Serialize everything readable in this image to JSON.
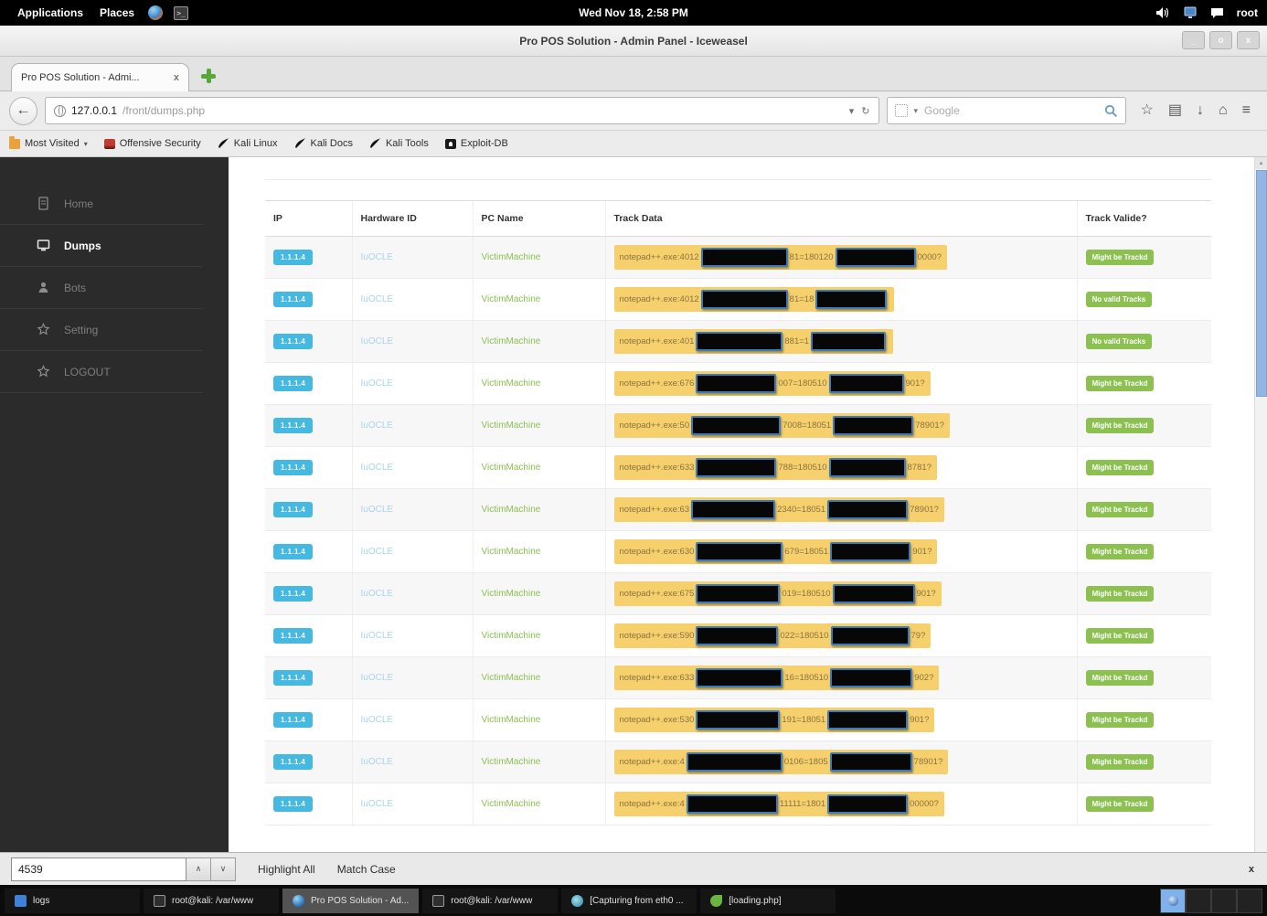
{
  "desktop": {
    "top_bar": {
      "menus": [
        "Applications",
        "Places"
      ],
      "clock": "Wed Nov 18, 2:58 PM",
      "user": "root"
    },
    "taskbar": {
      "items": [
        {
          "label": "logs",
          "icon": "file",
          "active": false
        },
        {
          "label": "root@kali: /var/www",
          "icon": "terminal",
          "active": false
        },
        {
          "label": "Pro POS Solution - Ad...",
          "icon": "iceweasel",
          "active": true
        },
        {
          "label": "root@kali: /var/www",
          "icon": "terminal",
          "active": false
        },
        {
          "label": "[Capturing from eth0 ...",
          "icon": "wireshark",
          "active": false
        },
        {
          "label": "[loading.php]",
          "icon": "script",
          "active": false
        }
      ],
      "workspace_count": 4,
      "active_workspace": 0
    }
  },
  "browser": {
    "window_title": "Pro POS Solution - Admin Panel - Iceweasel",
    "win_controls": {
      "minimize": "_",
      "maximize": "o",
      "close": "x"
    },
    "tab": {
      "title": "Pro POS Solution - Admi...",
      "close": "x"
    },
    "url": {
      "host": "127.0.0.1",
      "path": "/front/dumps.php"
    },
    "nav": {
      "back": "←",
      "url_caret": "▾",
      "reload": "↻",
      "search_caret": "▾",
      "star": "☆",
      "panel": "▤",
      "download": "↓",
      "home": "⌂",
      "menu": "≡"
    },
    "search_placeholder": "Google",
    "bookmarks": [
      {
        "label": "Most Visited",
        "icon": "folder",
        "caret": "▾"
      },
      {
        "label": "Offensive Security",
        "icon": "offsec"
      },
      {
        "label": "Kali Linux",
        "icon": "kali"
      },
      {
        "label": "Kali Docs",
        "icon": "kali"
      },
      {
        "label": "Kali Tools",
        "icon": "kali"
      },
      {
        "label": "Exploit-DB",
        "icon": "edb"
      }
    ],
    "findbar": {
      "query": "4539",
      "prev": "∧",
      "next": "∨",
      "highlight_all": "Highlight All",
      "match_case": "Match Case",
      "close": "x"
    },
    "scrollbar_arrow": "▴"
  },
  "page": {
    "sidebar": [
      {
        "label": "Home",
        "icon": "home",
        "active": false
      },
      {
        "label": "Dumps",
        "icon": "dumps",
        "active": true
      },
      {
        "label": "Bots",
        "icon": "bots",
        "active": false
      },
      {
        "label": "Setting",
        "icon": "setting",
        "active": false
      },
      {
        "label": "LOGOUT",
        "icon": "logout",
        "active": false
      }
    ],
    "table": {
      "headers": [
        "IP",
        "Hardware ID",
        "PC Name",
        "Track Data",
        "Track Valide?"
      ],
      "rows": [
        {
          "ip": "1.1.1.4",
          "hwid": "IuOCLE",
          "pc": "VictimMachine",
          "track": {
            "pre": "notepad++.exe:4012",
            "mid": "81=180120",
            "end": "0000?",
            "redact_widths": [
              95,
              88
            ]
          },
          "valid": "Might be Trackd"
        },
        {
          "ip": "1.1.1.4",
          "hwid": "IuOCLE",
          "pc": "VictimMachine",
          "track": {
            "pre": "notepad++.exe:4012",
            "mid": "81=18",
            "end": "",
            "redact_widths": [
              95,
              78
            ]
          },
          "valid": "No valid Tracks"
        },
        {
          "ip": "1.1.1.4",
          "hwid": "IuOCLE",
          "pc": "VictimMachine",
          "track": {
            "pre": "notepad++.exe:401",
            "mid": "881=1",
            "end": "",
            "redact_widths": [
              95,
              82
            ]
          },
          "valid": "No valid Tracks"
        },
        {
          "ip": "1.1.1.4",
          "hwid": "IuOCLE",
          "pc": "VictimMachine",
          "track": {
            "pre": "notepad++.exe:676",
            "mid": "007=180510",
            "end": "901?",
            "redact_widths": [
              88,
              82
            ]
          },
          "valid": "Might be Trackd"
        },
        {
          "ip": "1.1.1.4",
          "hwid": "IuOCLE",
          "pc": "VictimMachine",
          "track": {
            "pre": "notepad++.exe:50",
            "mid": "7008=18051",
            "end": "78901?",
            "redact_widths": [
              98,
              88
            ]
          },
          "valid": "Might be Trackd"
        },
        {
          "ip": "1.1.1.4",
          "hwid": "IuOCLE",
          "pc": "VictimMachine",
          "track": {
            "pre": "notepad++.exe:633",
            "mid": "788=180510",
            "end": "8781?",
            "redact_widths": [
              88,
              84
            ]
          },
          "valid": "Might be Trackd"
        },
        {
          "ip": "1.1.1.4",
          "hwid": "IuOCLE",
          "pc": "VictimMachine",
          "track": {
            "pre": "notepad++.exe:63",
            "mid": "2340=18051",
            "end": "78901?",
            "redact_widths": [
              92,
              88
            ]
          },
          "valid": "Might be Trackd"
        },
        {
          "ip": "1.1.1.4",
          "hwid": "IuOCLE",
          "pc": "VictimMachine",
          "track": {
            "pre": "notepad++.exe:630",
            "mid": "679=18051",
            "end": "901?",
            "redact_widths": [
              95,
              88
            ]
          },
          "valid": "Might be Trackd"
        },
        {
          "ip": "1.1.1.4",
          "hwid": "IuOCLE",
          "pc": "VictimMachine",
          "track": {
            "pre": "notepad++.exe:675",
            "mid": "019=180510",
            "end": "901?",
            "redact_widths": [
              92,
              90
            ]
          },
          "valid": "Might be Trackd"
        },
        {
          "ip": "1.1.1.4",
          "hwid": "IuOCLE",
          "pc": "VictimMachine",
          "track": {
            "pre": "notepad++.exe:590",
            "mid": "022=180510",
            "end": "79?",
            "redact_widths": [
              90,
              86
            ]
          },
          "valid": "Might be Trackd"
        },
        {
          "ip": "1.1.1.4",
          "hwid": "IuOCLE",
          "pc": "VictimMachine",
          "track": {
            "pre": "notepad++.exe:633",
            "mid": "16=180510",
            "end": "902?",
            "redact_widths": [
              95,
              90
            ]
          },
          "valid": "Might be Trackd"
        },
        {
          "ip": "1.1.1.4",
          "hwid": "IuOCLE",
          "pc": "VictimMachine",
          "track": {
            "pre": "notepad++.exe:530",
            "mid": "191=18051",
            "end": "901?",
            "redact_widths": [
              92,
              88
            ]
          },
          "valid": "Might be Trackd"
        },
        {
          "ip": "1.1.1.4",
          "hwid": "IuOCLE",
          "pc": "VictimMachine",
          "track": {
            "pre": "notepad++.exe:4",
            "mid": "0106=1805",
            "end": "78901?",
            "redact_widths": [
              105,
              90
            ]
          },
          "valid": "Might be Trackd"
        },
        {
          "ip": "1.1.1.4",
          "hwid": "IuOCLE",
          "pc": "VictimMachine",
          "track": {
            "pre": "notepad++.exe:4",
            "mid": "11111=1801",
            "end": "00000?",
            "redact_widths": [
              100,
              88
            ]
          },
          "valid": "Might be Trackd"
        }
      ]
    }
  },
  "colors": {
    "ip_badge": "#45b9e2",
    "hwid_link": "#a7d4ee",
    "pc_name": "#8cc152",
    "track_highlight": "#f5d06c",
    "redact_border": "#3d7ab8",
    "valid_badge": "#8cc152",
    "sidebar_bg": "#2b2b2b"
  }
}
